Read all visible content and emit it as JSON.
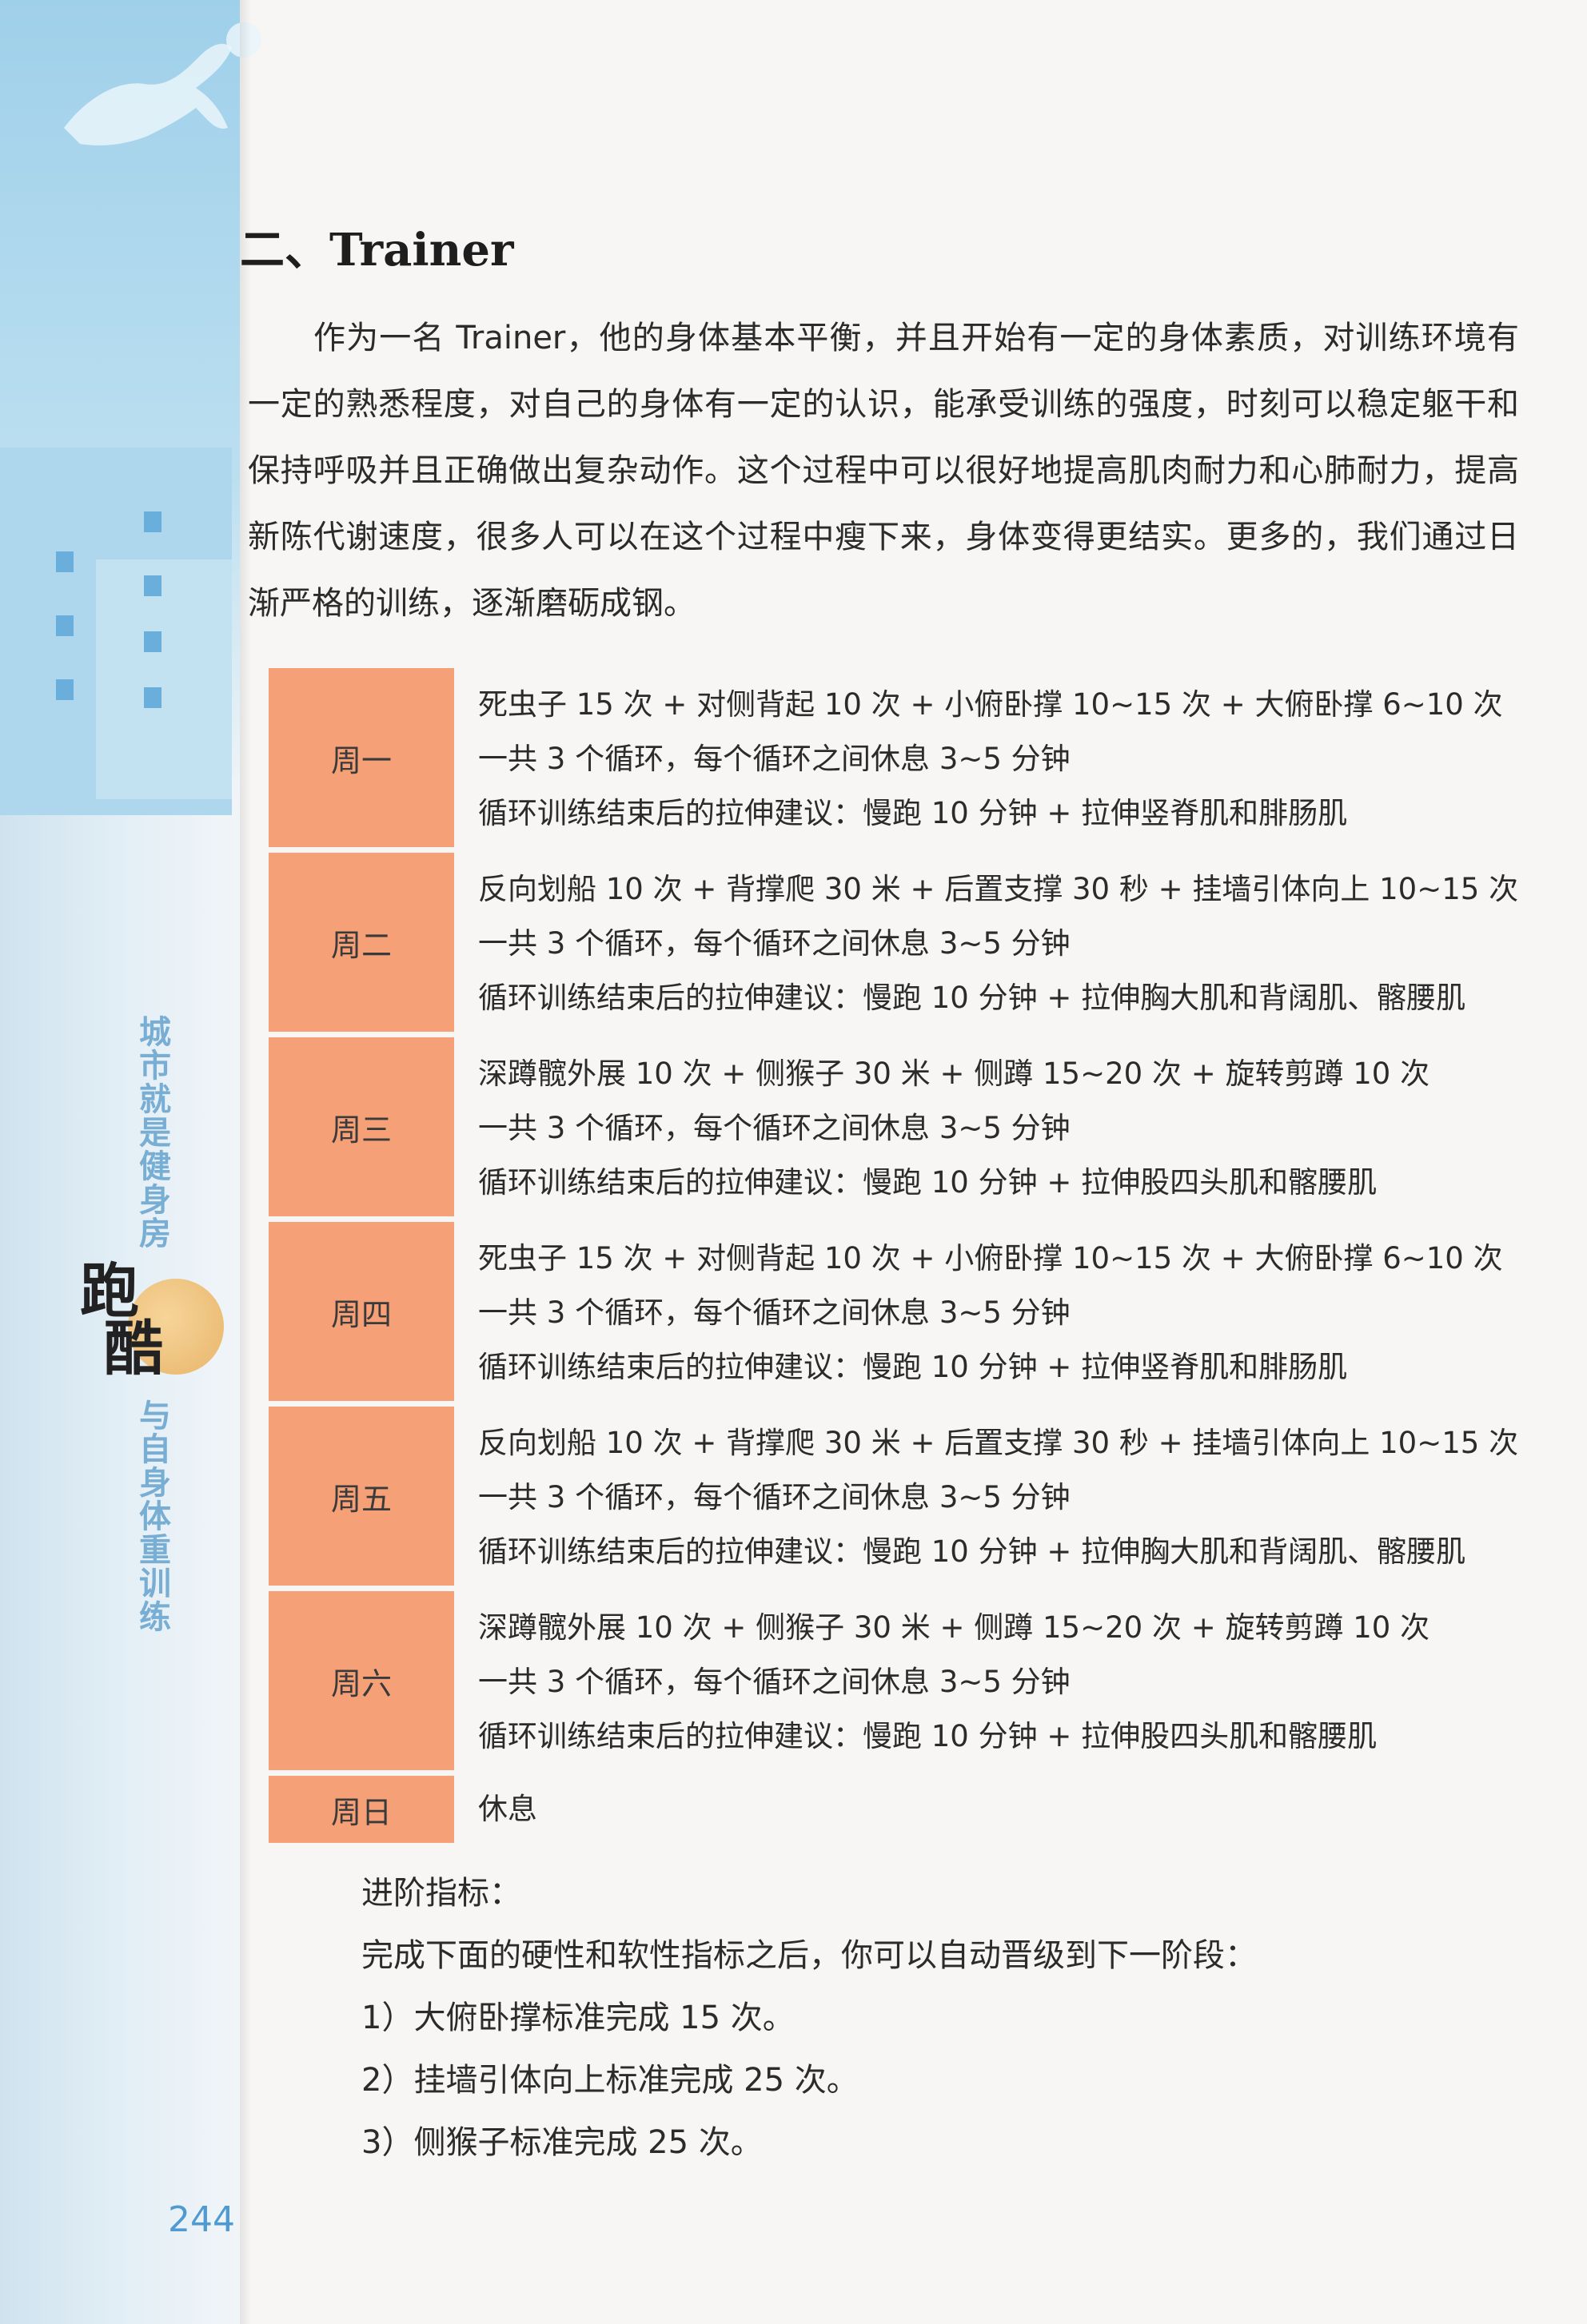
{
  "side": {
    "vertical_title_top": "城市就是健身房",
    "logo_text": [
      "跑",
      "酷"
    ],
    "vertical_title_bottom": "与自身体重训练",
    "page_number": "244"
  },
  "section": {
    "heading": "二、Trainer",
    "intro": "作为一名 Trainer，他的身体基本平衡，并且开始有一定的身体素质，对训练环境有一定的熟悉程度，对自己的身体有一定的认识，能承受训练的强度，时刻可以稳定躯干和保持呼吸并且正确做出复杂动作。这个过程中可以很好地提高肌肉耐力和心肺耐力，提高新陈代谢速度，很多人可以在这个过程中瘦下来，身体变得更结实。更多的，我们通过日渐严格的训练，逐渐磨砺成钢。"
  },
  "schedule": [
    {
      "day": "周一",
      "lines": [
        "死虫子 15 次 + 对侧背起 10 次 + 小俯卧撑 10~15 次 + 大俯卧撑 6~10 次",
        "一共 3 个循环，每个循环之间休息 3~5 分钟",
        "循环训练结束后的拉伸建议：慢跑 10 分钟 + 拉伸竖脊肌和腓肠肌"
      ]
    },
    {
      "day": "周二",
      "lines": [
        "反向划船 10 次 + 背撑爬 30 米 + 后置支撑 30 秒 + 挂墙引体向上 10~15 次",
        "一共 3 个循环，每个循环之间休息 3~5 分钟",
        "循环训练结束后的拉伸建议：慢跑 10 分钟 + 拉伸胸大肌和背阔肌、髂腰肌"
      ]
    },
    {
      "day": "周三",
      "lines": [
        "深蹲髋外展 10 次 + 侧猴子 30 米 + 侧蹲 15~20 次 + 旋转剪蹲 10 次",
        "一共 3 个循环，每个循环之间休息 3~5 分钟",
        "循环训练结束后的拉伸建议：慢跑 10 分钟 + 拉伸股四头肌和髂腰肌"
      ]
    },
    {
      "day": "周四",
      "lines": [
        "死虫子 15 次 + 对侧背起 10 次 + 小俯卧撑 10~15 次 + 大俯卧撑 6~10 次",
        "一共 3 个循环，每个循环之间休息 3~5 分钟",
        "循环训练结束后的拉伸建议：慢跑 10 分钟 + 拉伸竖脊肌和腓肠肌"
      ]
    },
    {
      "day": "周五",
      "lines": [
        "反向划船 10 次 + 背撑爬 30 米 + 后置支撑 30 秒 + 挂墙引体向上 10~15 次",
        "一共 3 个循环，每个循环之间休息 3~5 分钟",
        "循环训练结束后的拉伸建议：慢跑 10 分钟 + 拉伸胸大肌和背阔肌、髂腰肌"
      ]
    },
    {
      "day": "周六",
      "lines": [
        "深蹲髋外展 10 次 + 侧猴子 30 米 + 侧蹲 15~20 次 + 旋转剪蹲 10 次",
        "一共 3 个循环，每个循环之间休息 3~5 分钟",
        "循环训练结束后的拉伸建议：慢跑 10 分钟 + 拉伸股四头肌和髂腰肌"
      ]
    },
    {
      "day": "周日",
      "lines": [
        "休息"
      ]
    }
  ],
  "advance": {
    "title": "进阶指标：",
    "desc": "完成下面的硬性和软性指标之后，你可以自动晋级到下一阶段：",
    "items": [
      "1）大俯卧撑标准完成 15 次。",
      "2）挂墙引体向上标准完成 25 次。",
      "3）侧猴子标准完成 25 次。"
    ]
  }
}
